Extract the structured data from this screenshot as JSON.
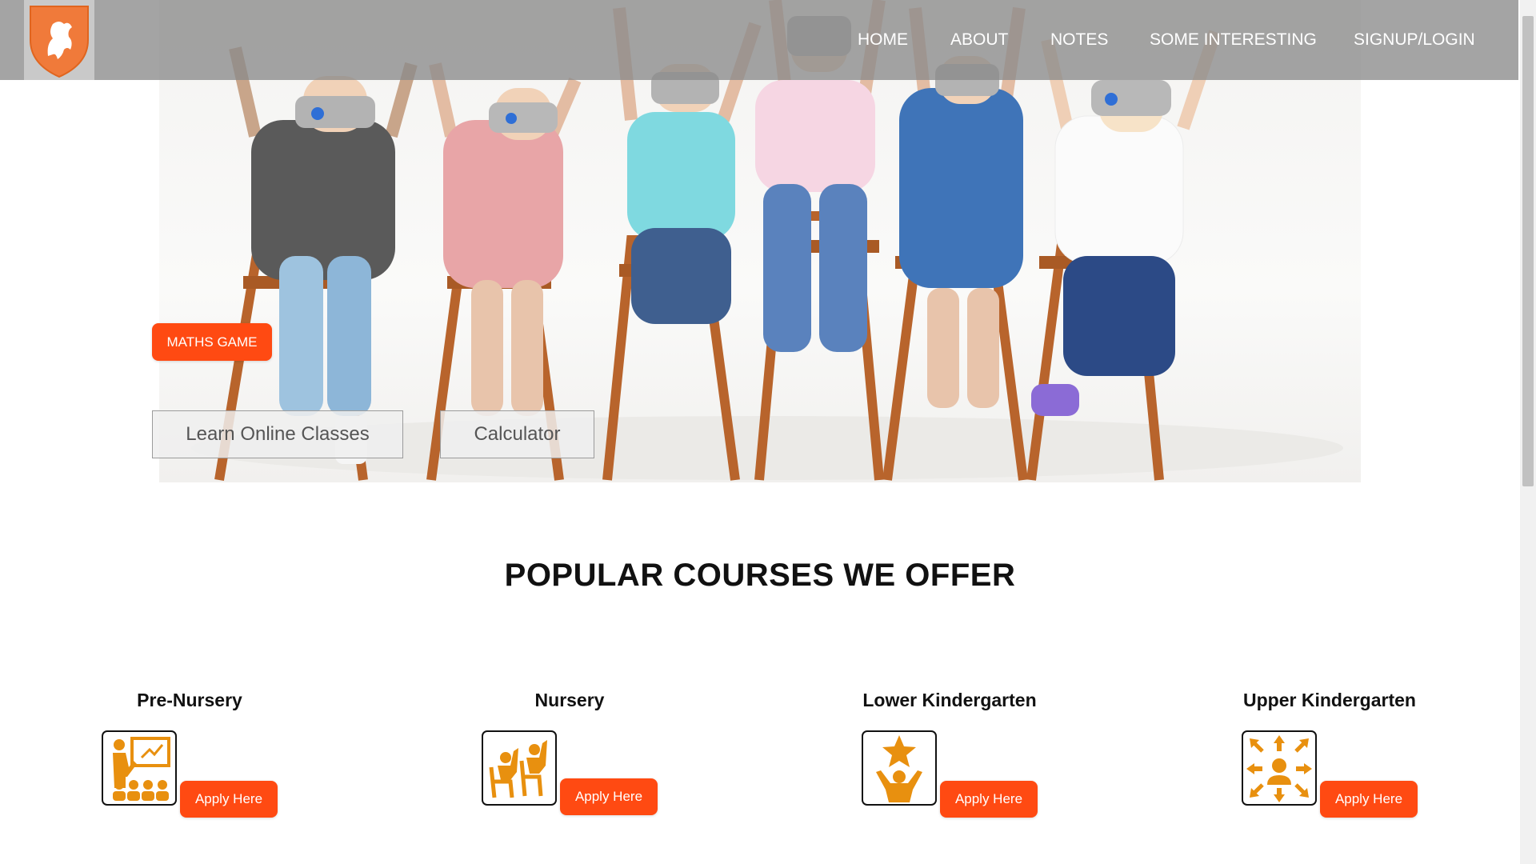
{
  "nav": {
    "links": [
      "HOME",
      "ABOUT",
      "NOTES",
      "SOME INTERESTING",
      "SIGNUP/LOGIN"
    ]
  },
  "hero": {
    "maths_game_label": "MATHS GAME",
    "learn_online_label": "Learn Online Classes",
    "calculator_label": "Calculator"
  },
  "courses": {
    "title": "POPULAR COURSES WE OFFER",
    "items": [
      {
        "name": "Pre-Nursery",
        "icon": "teacher-classroom-icon",
        "apply_label": "Apply Here"
      },
      {
        "name": "Nursery",
        "icon": "students-raising-hands-icon",
        "apply_label": "Apply Here"
      },
      {
        "name": "Lower Kindergarten",
        "icon": "star-achiever-icon",
        "apply_label": "Apply Here"
      },
      {
        "name": "Upper Kindergarten",
        "icon": "person-arrows-icon",
        "apply_label": "Apply Here"
      }
    ]
  },
  "colors": {
    "accent": "#ff4a12",
    "icon_orange": "#e8900f",
    "navbar": "#8a8a8a",
    "logo_shield": "#f07a3a"
  }
}
